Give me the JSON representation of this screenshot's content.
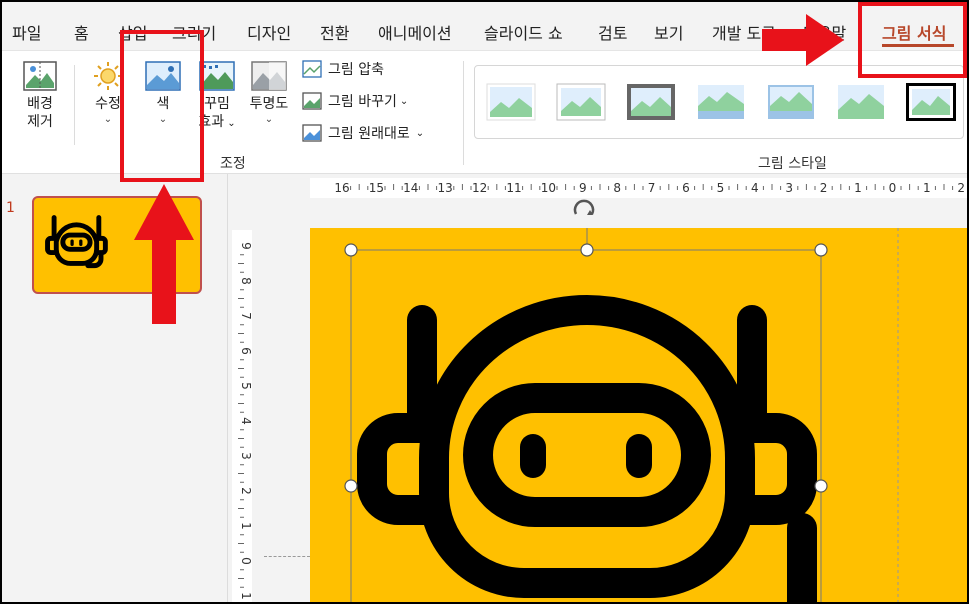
{
  "tabs": [
    {
      "label": "파일"
    },
    {
      "label": "홈"
    },
    {
      "label": "삽입"
    },
    {
      "label": "그리기"
    },
    {
      "label": "디자인"
    },
    {
      "label": "전환"
    },
    {
      "label": "애니메이션"
    },
    {
      "label": "슬라이드 쇼"
    },
    {
      "label": "검토"
    },
    {
      "label": "보기"
    },
    {
      "label": "개발 도구"
    },
    {
      "label": "도움말"
    },
    {
      "label": "그림 서식"
    }
  ],
  "ribbon": {
    "remove_bg_line1": "배경",
    "remove_bg_line2": "제거",
    "corrections": "수정",
    "color": "색",
    "artistic_line1": "꾸밈",
    "artistic_line2": "효과",
    "transparency": "투명도",
    "compress": "그림 압축",
    "change_picture": "그림 바꾸기",
    "reset_picture": "그림 원래대로",
    "adjust_group": "조정",
    "styles_group": "그림 스타일"
  },
  "slide_pane": {
    "slide_number": "1"
  },
  "ruler": {
    "h_labels": [
      "16",
      "15",
      "14",
      "13",
      "12",
      "11",
      "10",
      "9",
      "8",
      "7",
      "6",
      "5",
      "4",
      "3",
      "2",
      "1",
      "0",
      "1",
      "2"
    ],
    "v_labels": [
      "9",
      "8",
      "7",
      "6",
      "5",
      "4",
      "3",
      "2",
      "1",
      "0",
      "1"
    ]
  },
  "colors": {
    "accent": "#b7472a",
    "slide_bg": "#ffc000",
    "annotation": "#e8121a"
  }
}
